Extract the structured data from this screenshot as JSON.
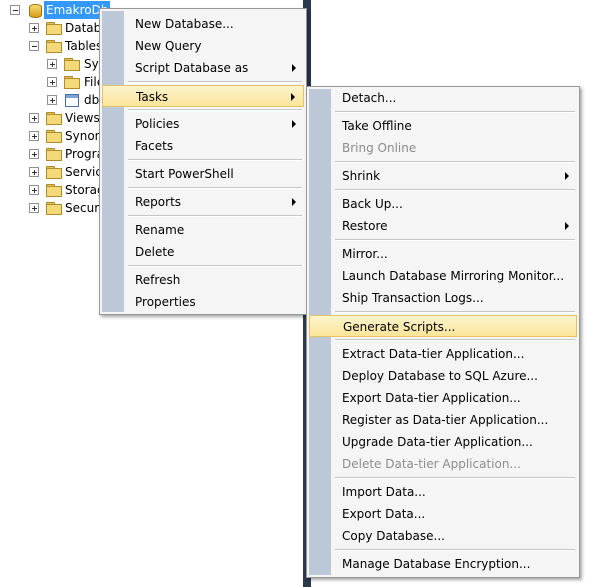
{
  "tree": {
    "root": "EmakroDb",
    "items": [
      {
        "label": "Databa"
      },
      {
        "label": "Tables"
      },
      {
        "label": "Sys"
      },
      {
        "label": "File"
      },
      {
        "label": "db"
      },
      {
        "label": "Views"
      },
      {
        "label": "Synony"
      },
      {
        "label": "Progra"
      },
      {
        "label": "Service"
      },
      {
        "label": "Storag"
      },
      {
        "label": "Securit"
      }
    ]
  },
  "context_menu": {
    "items": [
      {
        "label": "New Database..."
      },
      {
        "label": "New Query"
      },
      {
        "label": "Script Database as"
      },
      {
        "label": "Tasks"
      },
      {
        "label": "Policies"
      },
      {
        "label": "Facets"
      },
      {
        "label": "Start PowerShell"
      },
      {
        "label": "Reports"
      },
      {
        "label": "Rename"
      },
      {
        "label": "Delete"
      },
      {
        "label": "Refresh"
      },
      {
        "label": "Properties"
      }
    ]
  },
  "tasks_menu": {
    "items": [
      {
        "label": "Detach..."
      },
      {
        "label": "Take Offline"
      },
      {
        "label": "Bring Online"
      },
      {
        "label": "Shrink"
      },
      {
        "label": "Back Up..."
      },
      {
        "label": "Restore"
      },
      {
        "label": "Mirror..."
      },
      {
        "label": "Launch Database Mirroring Monitor..."
      },
      {
        "label": "Ship Transaction Logs..."
      },
      {
        "label": "Generate Scripts..."
      },
      {
        "label": "Extract Data-tier Application..."
      },
      {
        "label": "Deploy Database to SQL Azure..."
      },
      {
        "label": "Export Data-tier Application..."
      },
      {
        "label": "Register as Data-tier Application..."
      },
      {
        "label": "Upgrade Data-tier Application..."
      },
      {
        "label": "Delete Data-tier Application..."
      },
      {
        "label": "Import Data..."
      },
      {
        "label": "Export Data..."
      },
      {
        "label": "Copy Database..."
      },
      {
        "label": "Manage Database Encryption..."
      }
    ]
  }
}
